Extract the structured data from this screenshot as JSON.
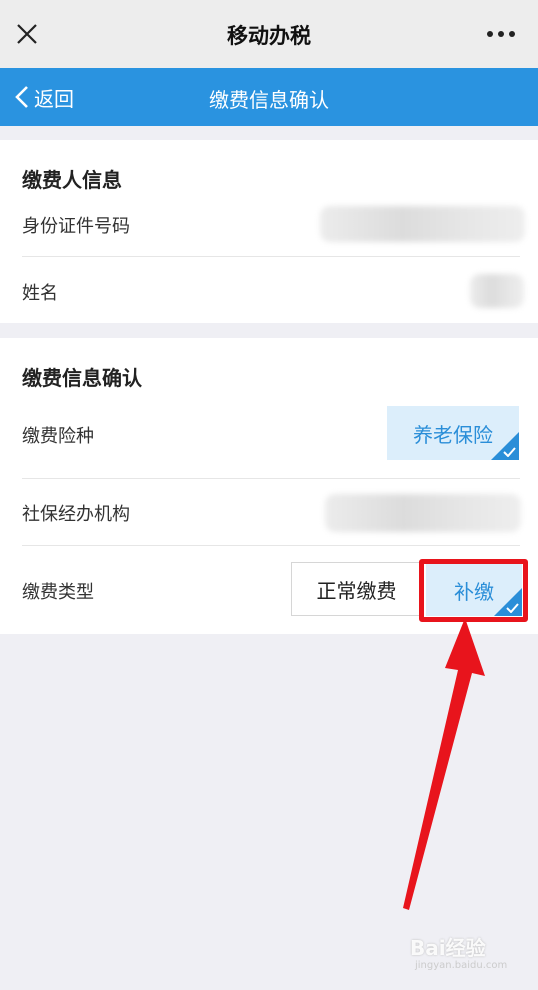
{
  "window": {
    "title": "移动办税"
  },
  "nav": {
    "back_label": "返回",
    "title": "缴费信息确认"
  },
  "payer_section": {
    "heading": "缴费人信息",
    "id_label": "身份证件号码",
    "name_label": "姓名"
  },
  "payment_section": {
    "heading": "缴费信息确认",
    "insurance_label": "缴费险种",
    "insurance_value": "养老保险",
    "agency_label": "社保经办机构",
    "type_label": "缴费类型",
    "type_options": [
      "正常缴费",
      "补缴"
    ],
    "type_selected": "补缴"
  },
  "watermark": {
    "brand": "Bai经验",
    "url": "jingyan.baidu.com"
  },
  "colors": {
    "accent": "#2a93e0",
    "highlight": "#e8141c",
    "selected_bg": "#dceefb"
  }
}
